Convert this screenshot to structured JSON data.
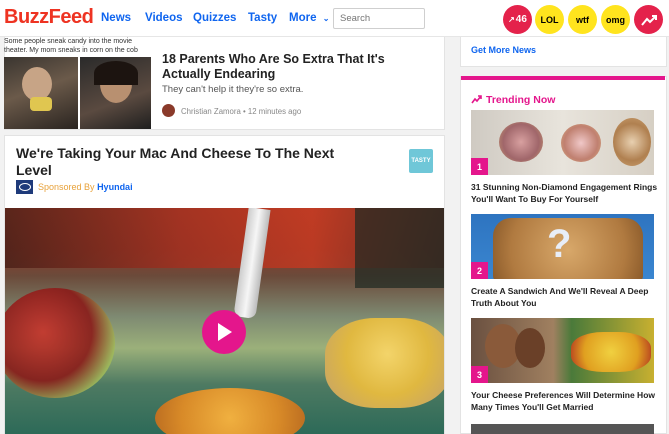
{
  "header": {
    "logo": "BuzzFeed",
    "nav": [
      "News",
      "Videos",
      "Quizzes",
      "Tasty",
      "More"
    ],
    "search_placeholder": "Search",
    "badges": [
      {
        "label": "46",
        "color": "#e4224b",
        "icon": "trending-up-icon"
      },
      {
        "label": "LOL",
        "color": "#ffe41e"
      },
      {
        "label": "wtf",
        "color": "#ffe41e"
      },
      {
        "label": "omg",
        "color": "#ffe41e"
      },
      {
        "label": "",
        "color": "#e4224b",
        "icon": "trending-arrow-icon"
      }
    ]
  },
  "feed": {
    "prev_caption": "Some people sneak candy into the movie theater. My mom sneaks in corn on the cob",
    "article1": {
      "title": "18 Parents Who Are So Extra That It's Actually Endearing",
      "subtitle": "They can't help it they're so extra.",
      "author": "Christian Zamora",
      "time": "12 minutes ago"
    },
    "article2": {
      "title": "We're Taking Your Mac And Cheese To The Next Level",
      "sponsored_prefix": "Sponsored By",
      "sponsor": "Hyundai",
      "badge": "TASTY"
    }
  },
  "sidebar": {
    "more_news": "Get More News",
    "trending_label": "Trending Now",
    "items": [
      {
        "rank": "1",
        "title": "31 Stunning Non-Diamond Engagement Rings You'll Want To Buy For Yourself"
      },
      {
        "rank": "2",
        "title": "Create A Sandwich And We'll Reveal A Deep Truth About You"
      },
      {
        "rank": "3",
        "title": "Your Cheese Preferences Will Determine How Many Times You'll Get Married"
      }
    ]
  },
  "colors": {
    "brand_red": "#ee3322",
    "link_blue": "#0f65ef",
    "trending_pink": "#e4168c"
  }
}
